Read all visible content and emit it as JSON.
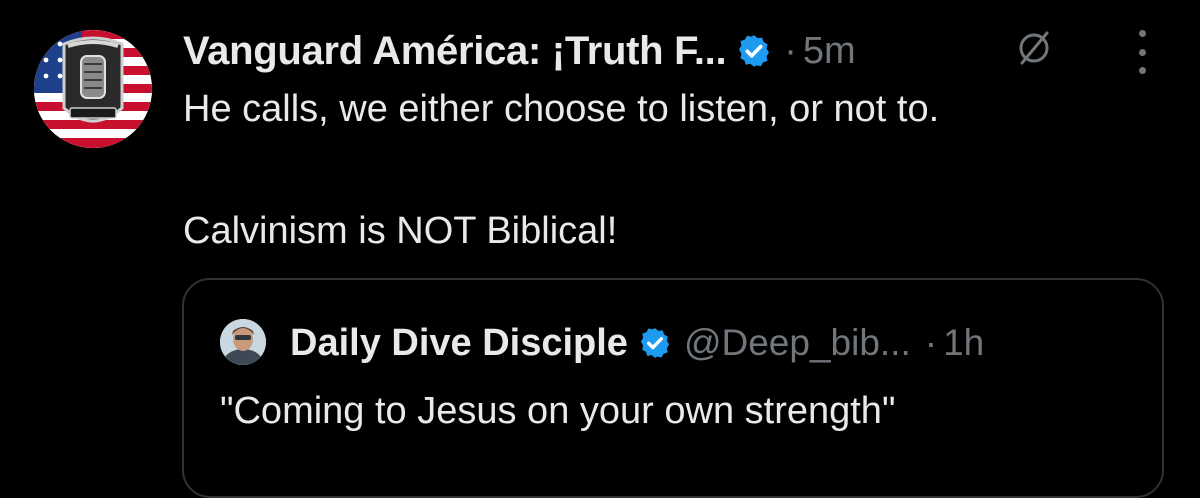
{
  "tweet": {
    "author": {
      "display_name": "Vanguard América: ¡Truth F...",
      "verified": true,
      "avatar_icon": "flag-microphone-avatar"
    },
    "separator": "·",
    "time": "5m",
    "lines": [
      "He calls, we either choose to listen, or not to.",
      "Calvinism is NOT Biblical!"
    ]
  },
  "quoted_tweet": {
    "author": {
      "display_name": "Daily Dive Disciple",
      "handle": "@Deep_bib...",
      "verified": true,
      "avatar_icon": "diver-portrait-avatar"
    },
    "separator": "·",
    "time": "1h",
    "text": "\"Coming to Jesus on your own strength\""
  },
  "colors": {
    "background": "#000000",
    "primary_text": "#e7e9ea",
    "secondary_text": "#71767b",
    "verified_badge": "#1d9bf0",
    "card_border": "#2f3336"
  }
}
